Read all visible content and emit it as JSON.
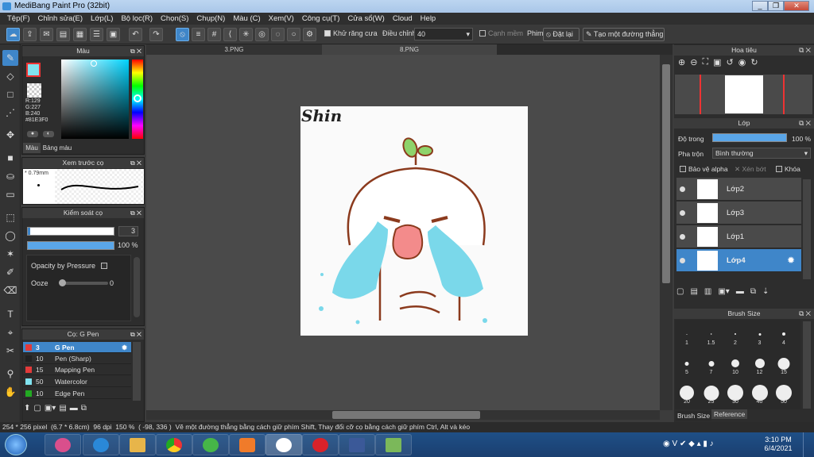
{
  "window": {
    "title": "MediBang Paint Pro (32bit)"
  },
  "menu": [
    "Tệp(F)",
    "Chỉnh sửa(E)",
    "Lớp(L)",
    "Bộ lọc(R)",
    "Chọn(S)",
    "Chụp(N)",
    "Màu (C)",
    "Xem(V)",
    "Công cụ(T)",
    "Cửa sổ(W)",
    "Cloud",
    "Help"
  ],
  "toolbar": {
    "antialias": "Khử răng cưa",
    "correction": "Điều chỉnh",
    "correction_value": "40",
    "snap_edge": "Cạnh mềm",
    "snap": "Phim",
    "reset": "Đặt lại",
    "create_line": "Tạo một đường thẳng"
  },
  "tabs": [
    {
      "label": "3.PNG"
    },
    {
      "label": "8.PNG"
    }
  ],
  "color_panel": {
    "title": "Màu",
    "r": "R:129",
    "g": "G:227",
    "b": "B:240",
    "hex": "#81E3F0",
    "tab1": "Màu",
    "tab2": "Bảng màu",
    "accent": "#81E3F0"
  },
  "brush_preview": {
    "title": "Xem trước cọ",
    "size": "0.79mm"
  },
  "brush_control": {
    "title": "Kiểm soát cọ",
    "size_value": "3",
    "opacity_value": "100 %",
    "opacity_fraction": 1.0,
    "opacity_pressure": "Opacity by Pressure",
    "ooze": "Ooze",
    "ooze_value": "0"
  },
  "brush_list": {
    "title": "Cọ: G Pen",
    "items": [
      {
        "size": "3",
        "name": "G Pen",
        "color": "#e23a3a"
      },
      {
        "size": "10",
        "name": "Pen (Sharp)",
        "color": "#222222"
      },
      {
        "size": "15",
        "name": "Mapping Pen",
        "color": "#e23a3a"
      },
      {
        "size": "50",
        "name": "Watercolor",
        "color": "#81E3F0"
      },
      {
        "size": "10",
        "name": "Edge Pen",
        "color": "#22aa22"
      }
    ]
  },
  "navigator": {
    "title": "Hoa tiêu"
  },
  "layers": {
    "title": "Lớp",
    "opacity_label": "Độ trong",
    "opacity_value": "100 %",
    "opacity_fraction": 1.0,
    "blend_label": "Pha trộn",
    "blend_value": "Bình thường",
    "protect_alpha": "Bảo vệ alpha",
    "clipping": "Xén bớt",
    "lock": "Khóa",
    "items": [
      {
        "name": "Lớp2"
      },
      {
        "name": "Lớp3"
      },
      {
        "name": "Lớp1"
      },
      {
        "name": "Lớp4"
      }
    ]
  },
  "brush_size": {
    "title": "Brush Size",
    "sizes": [
      "1",
      "1.5",
      "2",
      "3",
      "4",
      "5",
      "7",
      "10",
      "12",
      "15",
      "20",
      "25",
      "30",
      "40",
      "50"
    ],
    "tab1": "Brush Size",
    "tab2": "Reference"
  },
  "canvas": {
    "signature": "Shin"
  },
  "status": {
    "dims": "254 * 256 pixel",
    "cm": "(6.7 * 6.8cm)",
    "dpi": "96 dpi",
    "zoom": "150 %",
    "coords": "( -98, 336 )",
    "hint": "Vẽ một đường thẳng bằng cách giữ phím Shift, Thay đổi cỡ cọ bằng cách giữ phím Ctrl, Alt và kéo"
  },
  "clock": {
    "time": "3:10 PM",
    "date": "6/4/2021"
  }
}
